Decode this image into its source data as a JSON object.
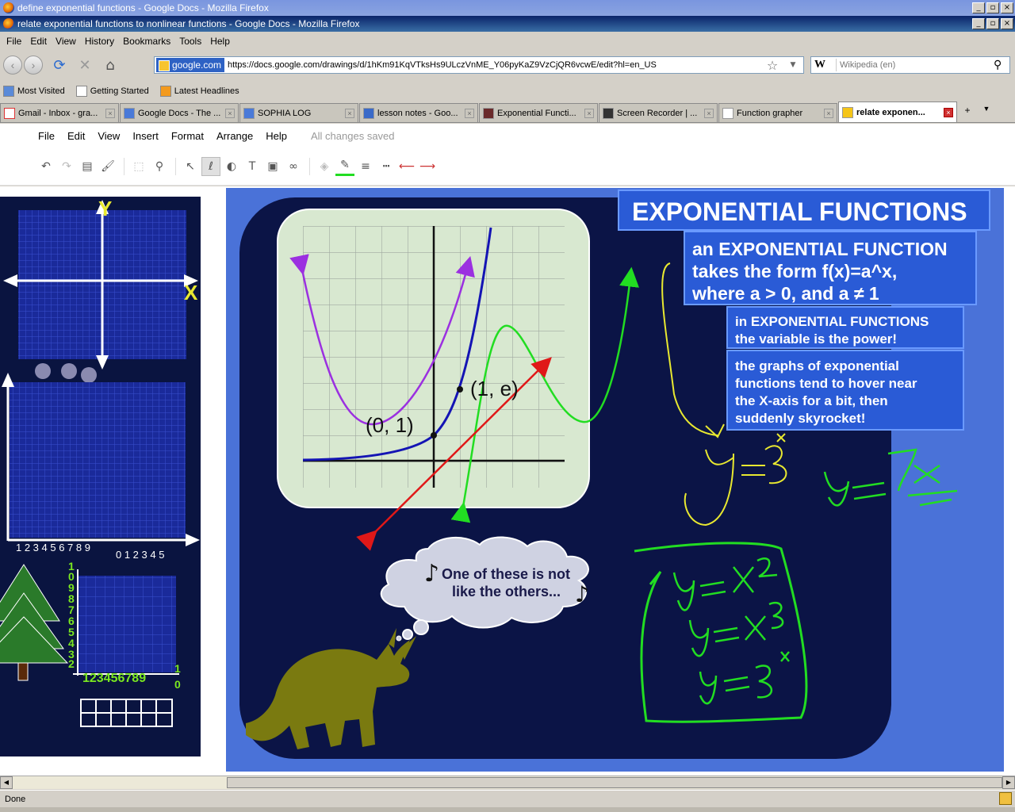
{
  "windows": {
    "background_title": "define exponential functions - Google Docs - Mozilla Firefox",
    "active_title": "relate exponential functions to nonlinear functions - Google Docs - Mozilla Firefox",
    "controls": [
      "_",
      "▫",
      "×"
    ]
  },
  "browser_menu": [
    "File",
    "Edit",
    "View",
    "History",
    "Bookmarks",
    "Tools",
    "Help"
  ],
  "navigation": {
    "site_identity": "google.com",
    "url": "https://docs.google.com/drawings/d/1hKm91KqVTksHs9ULczVnME_Y06pyKaZ9VzCjQR6vcwE/edit?hl=en_US",
    "search_engine": "W",
    "search_placeholder": "Wikipedia (en)"
  },
  "bookmarks": [
    "Most Visited",
    "Getting Started",
    "Latest Headlines"
  ],
  "tabs": [
    {
      "label": "Gmail - Inbox - gra...",
      "active": false
    },
    {
      "label": "Google Docs - The ...",
      "active": false
    },
    {
      "label": "SOPHIA LOG",
      "active": false
    },
    {
      "label": "lesson notes - Goo...",
      "active": false
    },
    {
      "label": "Exponential Functi...",
      "active": false
    },
    {
      "label": "Screen Recorder | ...",
      "active": false
    },
    {
      "label": "Function grapher",
      "active": false
    },
    {
      "label": "relate exponen...",
      "active": true
    }
  ],
  "doc_menu": [
    "File",
    "Edit",
    "View",
    "Insert",
    "Format",
    "Arrange",
    "Help"
  ],
  "save_status": "All changes saved",
  "left_panel": {
    "axis_y": "Y",
    "axis_x": "X",
    "x_ticks_a": "1 2 3 4 5 6 7 8 9",
    "x_ticks_b": "0 1 2 3 4 5",
    "small_y_ticks": [
      "1",
      "0",
      "9",
      "8",
      "7",
      "6",
      "5",
      "4",
      "3",
      "2",
      "1"
    ],
    "small_x_ticks": "123456789",
    "small_x_end": "1",
    "small_x_end2": "0"
  },
  "slide": {
    "title": "EXPONENTIAL FUNCTIONS",
    "def_line1": "an EXPONENTIAL FUNCTION",
    "def_line2": "takes the form f(x)=a^x,",
    "def_line3": "where a > 0, and a ≠ 1",
    "var_line1": "in EXPONENTIAL FUNCTIONS",
    "var_line2": "the variable is the power!",
    "graph_line1": "the graphs of exponential",
    "graph_line2": "functions tend to hover near",
    "graph_line3": "the X-axis for a bit, then",
    "graph_line4": "suddenly skyrocket!",
    "point_a": "(0, 1)",
    "point_b": "(1, e)",
    "thought_line1": "One of these is not",
    "thought_line2": "like the others...",
    "note_glyph": "♪"
  },
  "status_text": "Done",
  "colors": {
    "slide_bg": "#4a72d8",
    "slide_inner": "#0b1446",
    "title_box": "#2a5bd6",
    "grid_bg": "#d8e8d0",
    "green_ink": "#22dd22",
    "yellow_ink": "#e8e830",
    "purple_curve": "#9b30e0",
    "blue_curve": "#1414b4",
    "red_line": "#e01818",
    "dino": "#7a7a10"
  }
}
